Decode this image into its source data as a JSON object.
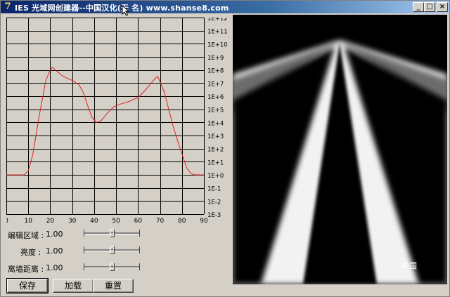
{
  "window": {
    "icon_glyph": "7",
    "title": "IES 光域网创建器--中国汉化(无  名) www.shanse8.com",
    "minimize_glyph": "_",
    "maximize_glyph": "□",
    "close_glyph": "×"
  },
  "graph": {
    "x_ticks": [
      "0",
      "10",
      "20",
      "30",
      "40",
      "50",
      "60",
      "70",
      "80",
      "90"
    ],
    "y_ticks": [
      "1E+12",
      "1E+11",
      "1E+10",
      "1E+9",
      "1E+8",
      "1E+7",
      "1E+6",
      "1E+5",
      "1E+4",
      "1E+3",
      "1E+2",
      "1E+1",
      "1E+0",
      "1E-1",
      "1E-2",
      "1E-3"
    ],
    "xlim": [
      0,
      90
    ],
    "ylim_exp": [
      -3,
      12
    ],
    "curve_color": "#e02020",
    "grid_color": "#000000",
    "curve": [
      [
        0,
        0
      ],
      [
        8,
        0
      ],
      [
        10,
        0.3
      ],
      [
        12,
        1.5
      ],
      [
        15,
        4.5
      ],
      [
        18,
        7.2
      ],
      [
        20,
        8
      ],
      [
        21,
        8.2
      ],
      [
        23,
        7.9
      ],
      [
        26,
        7.5
      ],
      [
        30,
        7.2
      ],
      [
        33,
        6.9
      ],
      [
        35,
        6.3
      ],
      [
        37,
        5.3
      ],
      [
        39,
        4.4
      ],
      [
        41,
        4.0
      ],
      [
        43,
        4.1
      ],
      [
        46,
        4.7
      ],
      [
        49,
        5.2
      ],
      [
        52,
        5.4
      ],
      [
        56,
        5.6
      ],
      [
        60,
        5.9
      ],
      [
        63,
        6.4
      ],
      [
        66,
        7.0
      ],
      [
        68,
        7.4
      ],
      [
        69,
        7.5
      ],
      [
        70,
        7.1
      ],
      [
        72,
        6.3
      ],
      [
        74,
        5.0
      ],
      [
        76,
        3.7
      ],
      [
        78,
        2.6
      ],
      [
        80,
        1.6
      ],
      [
        82,
        0.6
      ],
      [
        84,
        0.1
      ],
      [
        86,
        0
      ],
      [
        90,
        0
      ]
    ]
  },
  "preview": {
    "watermark": "中国"
  },
  "controls": [
    {
      "label": "编辑区域 :",
      "value": "1.00",
      "slider": 0.5
    },
    {
      "label": "亮度 :",
      "value": "1.00",
      "slider": 0.5
    },
    {
      "label": "离墙距离 :",
      "value": "1.00",
      "slider": 0.5
    }
  ],
  "buttons": {
    "save": "保存",
    "load": "加载",
    "reset": "重置"
  }
}
